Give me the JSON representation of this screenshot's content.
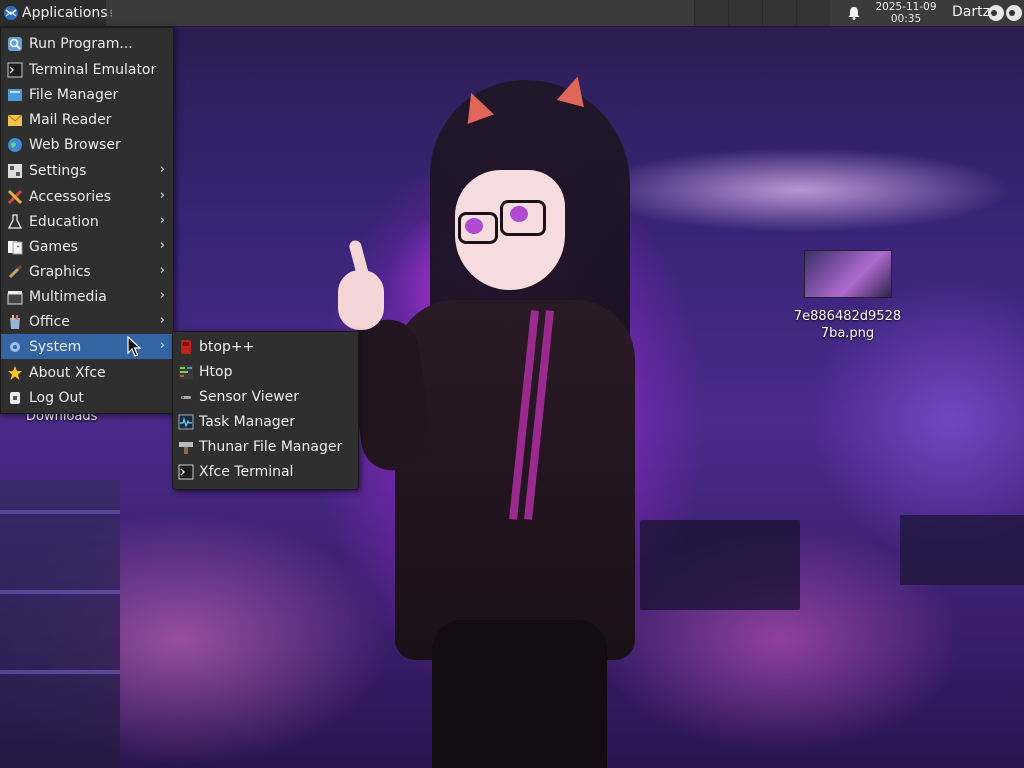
{
  "panel": {
    "apps_label": "Applications",
    "clock_date": "2025-11-09",
    "clock_time": "00:35",
    "user": "Dartz"
  },
  "desktop": {
    "file_name": "7e886482d95287ba.png",
    "downloads_label": "Downloads"
  },
  "main_menu": {
    "items": [
      {
        "label": "Run Program...",
        "icon": "search-run-icon",
        "submenu": false
      },
      {
        "label": "Terminal Emulator",
        "icon": "terminal-icon",
        "submenu": false
      },
      {
        "label": "File Manager",
        "icon": "folder-icon",
        "submenu": false
      },
      {
        "label": "Mail Reader",
        "icon": "mail-icon",
        "submenu": false
      },
      {
        "label": "Web Browser",
        "icon": "globe-icon",
        "submenu": false
      },
      {
        "label": "Settings",
        "icon": "settings-icon",
        "submenu": true
      },
      {
        "label": "Accessories",
        "icon": "accessories-icon",
        "submenu": true
      },
      {
        "label": "Education",
        "icon": "flask-icon",
        "submenu": true
      },
      {
        "label": "Games",
        "icon": "cards-icon",
        "submenu": true
      },
      {
        "label": "Graphics",
        "icon": "brush-icon",
        "submenu": true
      },
      {
        "label": "Multimedia",
        "icon": "clapper-icon",
        "submenu": true
      },
      {
        "label": "Office",
        "icon": "office-icon",
        "submenu": true
      },
      {
        "label": "System",
        "icon": "gear-icon",
        "submenu": true,
        "active": true
      },
      {
        "label": "About Xfce",
        "icon": "star-icon",
        "submenu": false
      },
      {
        "label": "Log Out",
        "icon": "logout-icon",
        "submenu": false
      }
    ]
  },
  "system_menu": {
    "items": [
      {
        "label": "btop++",
        "icon": "btop-icon"
      },
      {
        "label": "Htop",
        "icon": "htop-icon"
      },
      {
        "label": "Sensor Viewer",
        "icon": "sensor-icon"
      },
      {
        "label": "Task Manager",
        "icon": "task-manager-icon"
      },
      {
        "label": "Thunar File Manager",
        "icon": "thunar-icon"
      },
      {
        "label": "Xfce Terminal",
        "icon": "terminal-icon"
      }
    ]
  },
  "colors": {
    "menu_bg": "#2f2f2f",
    "highlight": "#3464a3",
    "panel_bg": "#3b3b3b"
  }
}
